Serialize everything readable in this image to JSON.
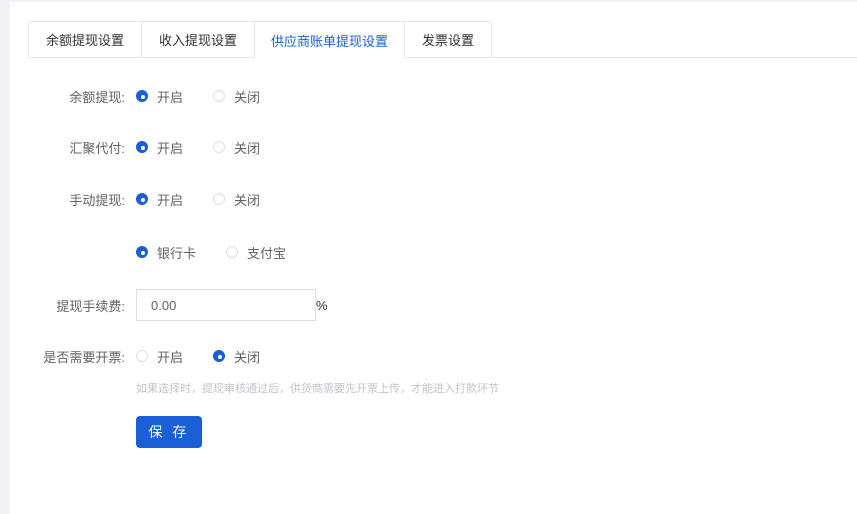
{
  "tabs": [
    "余额提现设置",
    "收入提现设置",
    "供应商账单提现设置",
    "发票设置"
  ],
  "active_tab": 2,
  "form": {
    "balance_withdraw": {
      "label": "余额提现:",
      "on": "开启",
      "off": "关闭",
      "value": "on"
    },
    "aggregate_pay": {
      "label": "汇聚代付:",
      "on": "开启",
      "off": "关闭",
      "value": "on"
    },
    "manual_withdraw": {
      "label": "手动提现:",
      "on": "开启",
      "off": "关闭",
      "value": "on"
    },
    "method": {
      "bank": "银行卡",
      "alipay": "支付宝",
      "value": "bank"
    },
    "fee": {
      "label": "提现手续费:",
      "value": "0.00",
      "unit": "%"
    },
    "invoice": {
      "label": "是否需要开票:",
      "on": "开启",
      "off": "关闭",
      "value": "off",
      "hint": "如果选择时，提现审核通过后，供货商需要先开票上传，才能进入打款环节"
    },
    "save": "保 存"
  },
  "colors": {
    "accent": "#1a5fd6"
  }
}
